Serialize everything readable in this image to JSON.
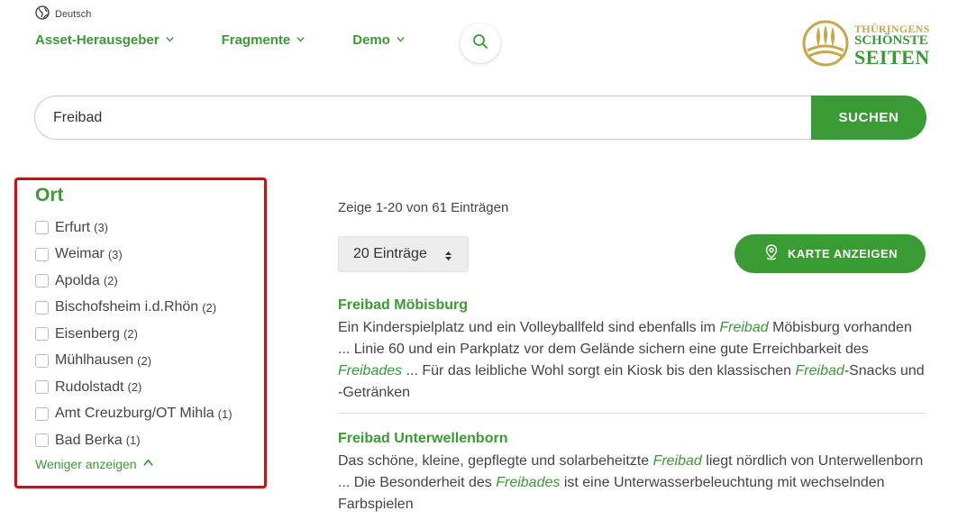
{
  "language": {
    "label": "Deutsch",
    "icon": "globe-icon"
  },
  "nav": {
    "items": [
      {
        "label": "Asset-Herausgeber",
        "icon": "chevron-down-icon"
      },
      {
        "label": "Fragmente",
        "icon": "chevron-down-icon"
      },
      {
        "label": "Demo",
        "icon": "chevron-down-icon"
      }
    ],
    "search_icon": "search-icon"
  },
  "logo": {
    "line1": "THÜRINGENS",
    "line2": "SCHÖNSTE",
    "line3": "SEITEN"
  },
  "search": {
    "value": "Freibad",
    "button_label": "SUCHEN"
  },
  "filter": {
    "title": "Ort",
    "items": [
      {
        "label": "Erfurt",
        "count": "(3)"
      },
      {
        "label": "Weimar",
        "count": "(3)"
      },
      {
        "label": "Apolda",
        "count": "(2)"
      },
      {
        "label": "Bischofsheim i.d.Rhön",
        "count": "(2)"
      },
      {
        "label": "Eisenberg",
        "count": "(2)"
      },
      {
        "label": "Mühlhausen",
        "count": "(2)"
      },
      {
        "label": "Rudolstadt",
        "count": "(2)"
      },
      {
        "label": "Amt Creuzburg/OT Mihla",
        "count": "(1)"
      },
      {
        "label": "Bad Berka",
        "count": "(1)"
      }
    ],
    "show_less_label": "Weniger anzeigen"
  },
  "results": {
    "info": "Zeige 1-20 von 61 Einträgen",
    "per_page": "20 Einträge",
    "map_button_label": "KARTE ANZEIGEN",
    "items": [
      {
        "title": "Freibad Möbisburg",
        "snippet": [
          {
            "t": "Ein Kinderspielplatz und ein Volleyballfeld sind ebenfalls im "
          },
          {
            "t": "Freibad",
            "hl": true
          },
          {
            "t": " Möbisburg vorhanden ... Linie 60 und ein Parkplatz vor dem Gelände sichern eine gute Erreichbarkeit des "
          },
          {
            "t": "Freibades",
            "hl": true
          },
          {
            "t": " ... Für das leibliche Wohl sorgt ein Kiosk bis den klassischen "
          },
          {
            "t": "Freibad",
            "hl": true
          },
          {
            "t": "-Snacks und -Getränken"
          }
        ]
      },
      {
        "title": "Freibad Unterwellenborn",
        "snippet": [
          {
            "t": "Das schöne, kleine, gepflegte und solarbeheitzte "
          },
          {
            "t": "Freibad",
            "hl": true
          },
          {
            "t": " liegt nördlich von Unterwellenborn ... Die Besonderheit des "
          },
          {
            "t": "Freibades",
            "hl": true
          },
          {
            "t": " ist eine Unterwasserbeleuchtung mit wechselnden Farbspielen"
          }
        ]
      }
    ]
  },
  "colors": {
    "accent": "#3a9a33",
    "highlight_border": "#c8101a",
    "gold": "#c9a54b"
  }
}
